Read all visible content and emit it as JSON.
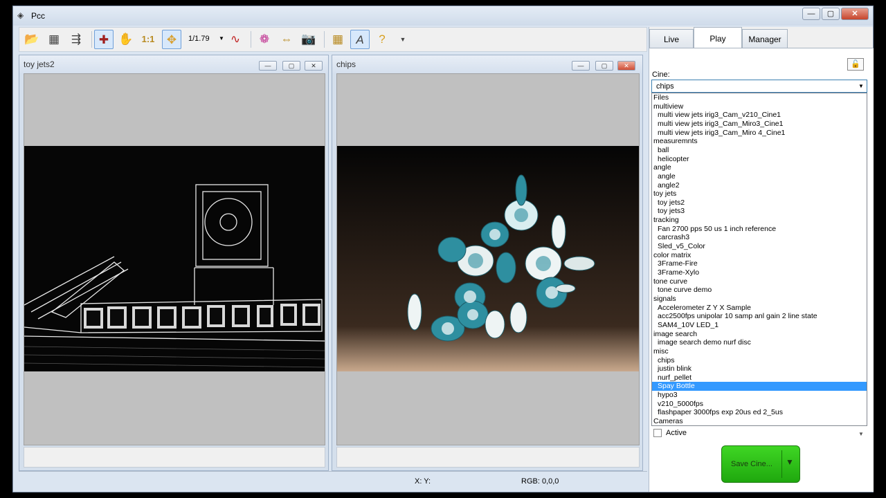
{
  "window": {
    "title": "Pcc",
    "buttons": [
      "minimize",
      "maximize",
      "close"
    ]
  },
  "toolbar": {
    "zoom_label": "1/1.79"
  },
  "views": [
    {
      "title": "toy jets2"
    },
    {
      "title": "chips"
    }
  ],
  "statusbar": {
    "coords": "X: Y:",
    "rgb": "RGB: 0,0,0"
  },
  "tabs": [
    {
      "label": "Live",
      "active": false
    },
    {
      "label": "Play",
      "active": true
    },
    {
      "label": "Manager",
      "active": false
    }
  ],
  "play": {
    "cine_label": "Cine:",
    "cine_selected": "chips",
    "dropdown_items": [
      {
        "text": "Files",
        "level": 0
      },
      {
        "text": "multiview",
        "level": 0
      },
      {
        "text": "multi view jets irig3_Cam_v210_Cine1",
        "level": 1
      },
      {
        "text": "multi view jets irig3_Cam_Miro3_Cine1",
        "level": 1
      },
      {
        "text": "multi view jets irig3_Cam_Miro 4_Cine1",
        "level": 1
      },
      {
        "text": "measuremnts",
        "level": 0
      },
      {
        "text": "ball",
        "level": 1
      },
      {
        "text": "helicopter",
        "level": 1
      },
      {
        "text": "angle",
        "level": 0
      },
      {
        "text": "angle",
        "level": 1
      },
      {
        "text": "angle2",
        "level": 1
      },
      {
        "text": "toy jets",
        "level": 0
      },
      {
        "text": "toy jets2",
        "level": 1
      },
      {
        "text": "toy jets3",
        "level": 1
      },
      {
        "text": "tracking",
        "level": 0
      },
      {
        "text": "Fan 2700 pps 50 us 1 inch reference",
        "level": 1
      },
      {
        "text": "carcrash3",
        "level": 1
      },
      {
        "text": "Sled_v5_Color",
        "level": 1
      },
      {
        "text": "color matrix",
        "level": 0
      },
      {
        "text": "3Frame-Fire",
        "level": 1
      },
      {
        "text": "3Frame-Xylo",
        "level": 1
      },
      {
        "text": "tone curve",
        "level": 0
      },
      {
        "text": "tone curve demo",
        "level": 1
      },
      {
        "text": "signals",
        "level": 0
      },
      {
        "text": "Accelerometer Z Y X Sample",
        "level": 1
      },
      {
        "text": "acc2500fps unipolar 10 samp anl gain 2 line state",
        "level": 1
      },
      {
        "text": "SAM4_10V LED_1",
        "level": 1
      },
      {
        "text": "image search",
        "level": 0
      },
      {
        "text": "image search demo nurf disc",
        "level": 1
      },
      {
        "text": "misc",
        "level": 0
      },
      {
        "text": "chips",
        "level": 1
      },
      {
        "text": "justin blink",
        "level": 1
      },
      {
        "text": "nurf_pellet",
        "level": 1
      },
      {
        "text": "Spay Bottle",
        "level": 1,
        "highlighted": true
      },
      {
        "text": "hypo3",
        "level": 1
      },
      {
        "text": "v210_5000fps",
        "level": 1
      },
      {
        "text": "flashpaper 3000fps exp 20us ed 2_5us",
        "level": 1
      },
      {
        "text": "Cameras",
        "level": 0
      }
    ],
    "active_label": "Active",
    "save_button": "Save Cine..."
  }
}
